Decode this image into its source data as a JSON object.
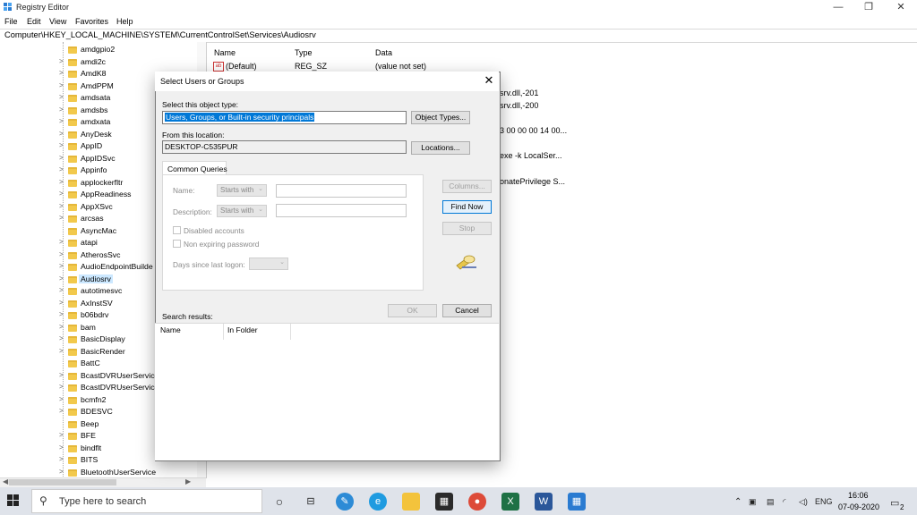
{
  "window": {
    "title": "Registry Editor",
    "controls": {
      "minimize": "—",
      "maximize": "❐",
      "close": "✕"
    }
  },
  "menu": [
    "File",
    "Edit",
    "View",
    "Favorites",
    "Help"
  ],
  "address": "Computer\\HKEY_LOCAL_MACHINE\\SYSTEM\\CurrentControlSet\\Services\\Audiosrv",
  "tree": {
    "items": [
      {
        "label": "amdgpio2",
        "chev": ""
      },
      {
        "label": "amdi2c",
        "chev": ">"
      },
      {
        "label": "AmdK8",
        "chev": ">"
      },
      {
        "label": "AmdPPM",
        "chev": ">"
      },
      {
        "label": "amdsata",
        "chev": ">"
      },
      {
        "label": "amdsbs",
        "chev": ">"
      },
      {
        "label": "amdxata",
        "chev": ">"
      },
      {
        "label": "AnyDesk",
        "chev": ">"
      },
      {
        "label": "AppID",
        "chev": ">"
      },
      {
        "label": "AppIDSvc",
        "chev": ">"
      },
      {
        "label": "Appinfo",
        "chev": ">"
      },
      {
        "label": "applockerfltr",
        "chev": ">"
      },
      {
        "label": "AppReadiness",
        "chev": ">"
      },
      {
        "label": "AppXSvc",
        "chev": ">"
      },
      {
        "label": "arcsas",
        "chev": ">"
      },
      {
        "label": "AsyncMac",
        "chev": ""
      },
      {
        "label": "atapi",
        "chev": ">"
      },
      {
        "label": "AtherosSvc",
        "chev": ">"
      },
      {
        "label": "AudioEndpointBuilde",
        "chev": ">"
      },
      {
        "label": "Audiosrv",
        "chev": ">",
        "selected": true
      },
      {
        "label": "autotimesvc",
        "chev": ">"
      },
      {
        "label": "AxInstSV",
        "chev": ">"
      },
      {
        "label": "b06bdrv",
        "chev": ">"
      },
      {
        "label": "bam",
        "chev": ">"
      },
      {
        "label": "BasicDisplay",
        "chev": ">"
      },
      {
        "label": "BasicRender",
        "chev": ">"
      },
      {
        "label": "BattC",
        "chev": ""
      },
      {
        "label": "BcastDVRUserService",
        "chev": ">"
      },
      {
        "label": "BcastDVRUserService",
        "chev": ">"
      },
      {
        "label": "bcmfn2",
        "chev": ">"
      },
      {
        "label": "BDESVC",
        "chev": ">"
      },
      {
        "label": "Beep",
        "chev": ""
      },
      {
        "label": "BFE",
        "chev": ">"
      },
      {
        "label": "bindflt",
        "chev": ">"
      },
      {
        "label": "BITS",
        "chev": ">"
      },
      {
        "label": "BluetoothUserService",
        "chev": ">"
      }
    ]
  },
  "values": {
    "headers": {
      "name": "Name",
      "type": "Type",
      "data": "Data"
    },
    "default_row": {
      "icon": "ab",
      "name": "(Default)",
      "type": "REG_SZ",
      "data": "(value not set)"
    },
    "partial": [
      "srv.dll,-201",
      "srv.dll,-200",
      "3 00 00 00 14 00...",
      "exe -k LocalSer...",
      "onatePrivilege S..."
    ]
  },
  "dialog": {
    "title": "Select Users or Groups",
    "close": "✕",
    "object_type_label": "Select this object type:",
    "object_type_value": "Users, Groups, or Built-in security principals",
    "object_types_btn": "Object Types...",
    "location_label": "From this location:",
    "location_value": "DESKTOP-C535PUR",
    "locations_btn": "Locations...",
    "tab": "Common Queries",
    "name_label": "Name:",
    "desc_label": "Description:",
    "starts_with": "Starts with",
    "disabled_accounts": "Disabled accounts",
    "non_expiring": "Non expiring password",
    "days_label": "Days since last logon:",
    "columns_btn": "Columns...",
    "find_now_btn": "Find Now",
    "stop_btn": "Stop",
    "ok_btn": "OK",
    "cancel_btn": "Cancel",
    "results_label": "Search results:",
    "results_cols": {
      "name": "Name",
      "folder": "In Folder"
    }
  },
  "taskbar": {
    "search_placeholder": "Type here to search",
    "tray": {
      "lang": "ENG"
    },
    "time": "16:06",
    "date": "07-09-2020",
    "notif_count": "2"
  },
  "colors": {
    "accent": "#0078d7",
    "selection": "#cce8ff",
    "folder": "#f2c94c"
  }
}
